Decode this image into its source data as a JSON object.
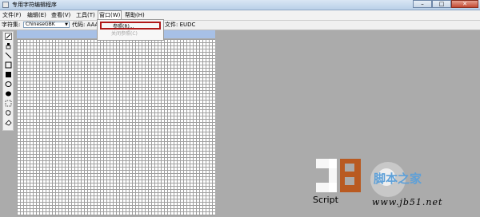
{
  "window": {
    "title": "专用字符编辑程序",
    "buttons": [
      "–",
      "□",
      "✕"
    ]
  },
  "menubar": {
    "items": [
      "文件(F)",
      "编辑(E)",
      "查看(V)",
      "工具(T)",
      "窗口(W)",
      "帮助(H)"
    ]
  },
  "window_menu": {
    "items": [
      "参照(R)...",
      "关闭参照(C)"
    ],
    "highlighted": "参照(R)..."
  },
  "toolbar": {
    "charset_label": "字符集:",
    "charset_value": "ChineseGBK",
    "code_label": "代码: AAA",
    "file_text": "文件: EUDC"
  },
  "tools": [
    "pencil-icon",
    "brush-icon",
    "line-icon",
    "hollow-rectangle-icon",
    "filled-rectangle-icon",
    "hollow-ellipse-icon",
    "filled-ellipse-icon",
    "select-rectangle-icon",
    "freeform-select-icon",
    "eraser-icon"
  ],
  "watermark": {
    "brand_cn": "脚本之家",
    "brand_word": "Script",
    "url": "www.jb51.net"
  }
}
